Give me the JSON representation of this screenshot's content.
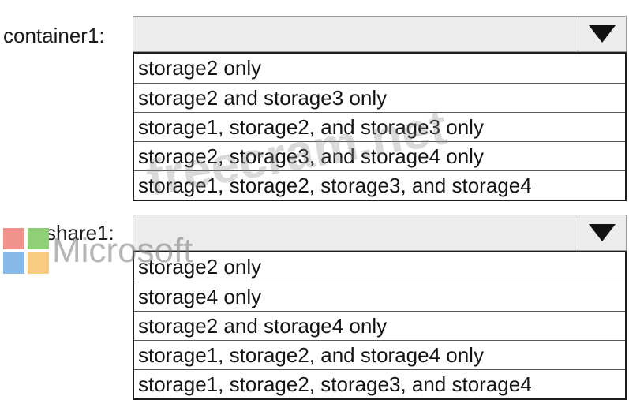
{
  "dropdown1": {
    "label": "container1:",
    "selected": "",
    "options": [
      "storage2 only",
      "storage2 and storage3 only",
      "storage1, storage2, and storage3 only",
      "storage2, storage3, and storage4 only",
      "storage1, storage2, storage3, and storage4"
    ]
  },
  "dropdown2": {
    "label": "share1:",
    "selected": "",
    "options": [
      "storage2 only",
      "storage4 only",
      "storage2 and storage4 only",
      "storage1, storage2, and storage4 only",
      "storage1, storage2, storage3, and storage4"
    ]
  },
  "watermark": {
    "site": "freecram.net",
    "brand": "Microsoft"
  },
  "colors": {
    "select_bg": "#ececec",
    "border": "#1d1d1d",
    "arrow": "#111111",
    "logo": [
      "#f0938c",
      "#8fcf76",
      "#86b8e8",
      "#f8cb80"
    ]
  },
  "icons": {
    "dropdown_arrow": "chevron-down-icon",
    "logo": "microsoft-logo-icon"
  }
}
